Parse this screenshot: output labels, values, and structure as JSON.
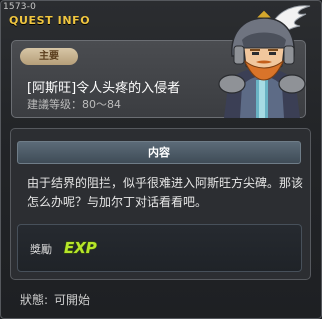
{
  "window": {
    "quest_id": "1573-0",
    "title": "QUEST INFO"
  },
  "summary": {
    "type_badge": "主要",
    "quest_name": "[阿斯旺]令人头疼的入侵者",
    "level_requirement": "建議等级：80～84"
  },
  "content": {
    "header": "内容",
    "description": "由于结界的阻拦，似乎很难进入阿斯旺方尖碑。那该怎么办呢？与加尔丁对话看看吧。"
  },
  "rewards": {
    "label": "獎勵",
    "icon": "exp-icon",
    "icon_text": "EXP"
  },
  "status": {
    "label": "狀態:",
    "value": "可開始"
  },
  "colors": {
    "title_gold": "#f0c640",
    "exp_green": "#b7e62a",
    "badge_tan": "#c9b48e",
    "header_blue": "#4f5e6b"
  }
}
